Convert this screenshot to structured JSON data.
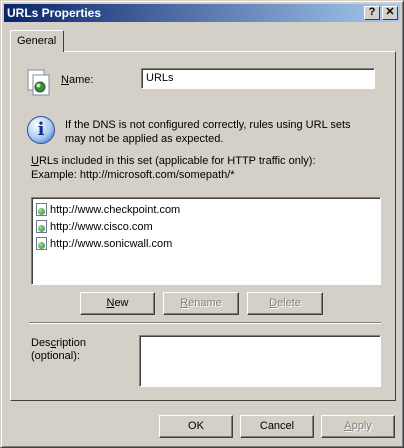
{
  "window": {
    "title": "URLs Properties",
    "help_glyph": "?",
    "close_glyph": "✕"
  },
  "tabs": [
    {
      "label": "General"
    }
  ],
  "name_field": {
    "label_mnemonic": "N",
    "label_rest": "ame:",
    "value": "URLs"
  },
  "info": {
    "text": "If the DNS is not configured correctly, rules using URL sets may not be applied as expected."
  },
  "urls_section": {
    "label_mnemonic": "U",
    "label_rest": "RLs included in this set (applicable for HTTP traffic only):",
    "example": "Example: http://microsoft.com/somepath/*",
    "items": [
      "http://www.checkpoint.com",
      "http://www.cisco.com",
      "http://www.sonicwall.com"
    ],
    "buttons": {
      "new_mnemonic": "N",
      "new_rest": "ew",
      "rename_mnemonic": "R",
      "rename_rest": "ename",
      "delete_mnemonic": "D",
      "delete_rest": "elete"
    }
  },
  "description": {
    "label_pre": "Des",
    "label_mnemonic": "c",
    "label_post": "ription",
    "label_line2": "(optional):",
    "value": ""
  },
  "footer": {
    "ok": "OK",
    "cancel": "Cancel",
    "apply_mnemonic": "A",
    "apply_rest": "pply"
  }
}
